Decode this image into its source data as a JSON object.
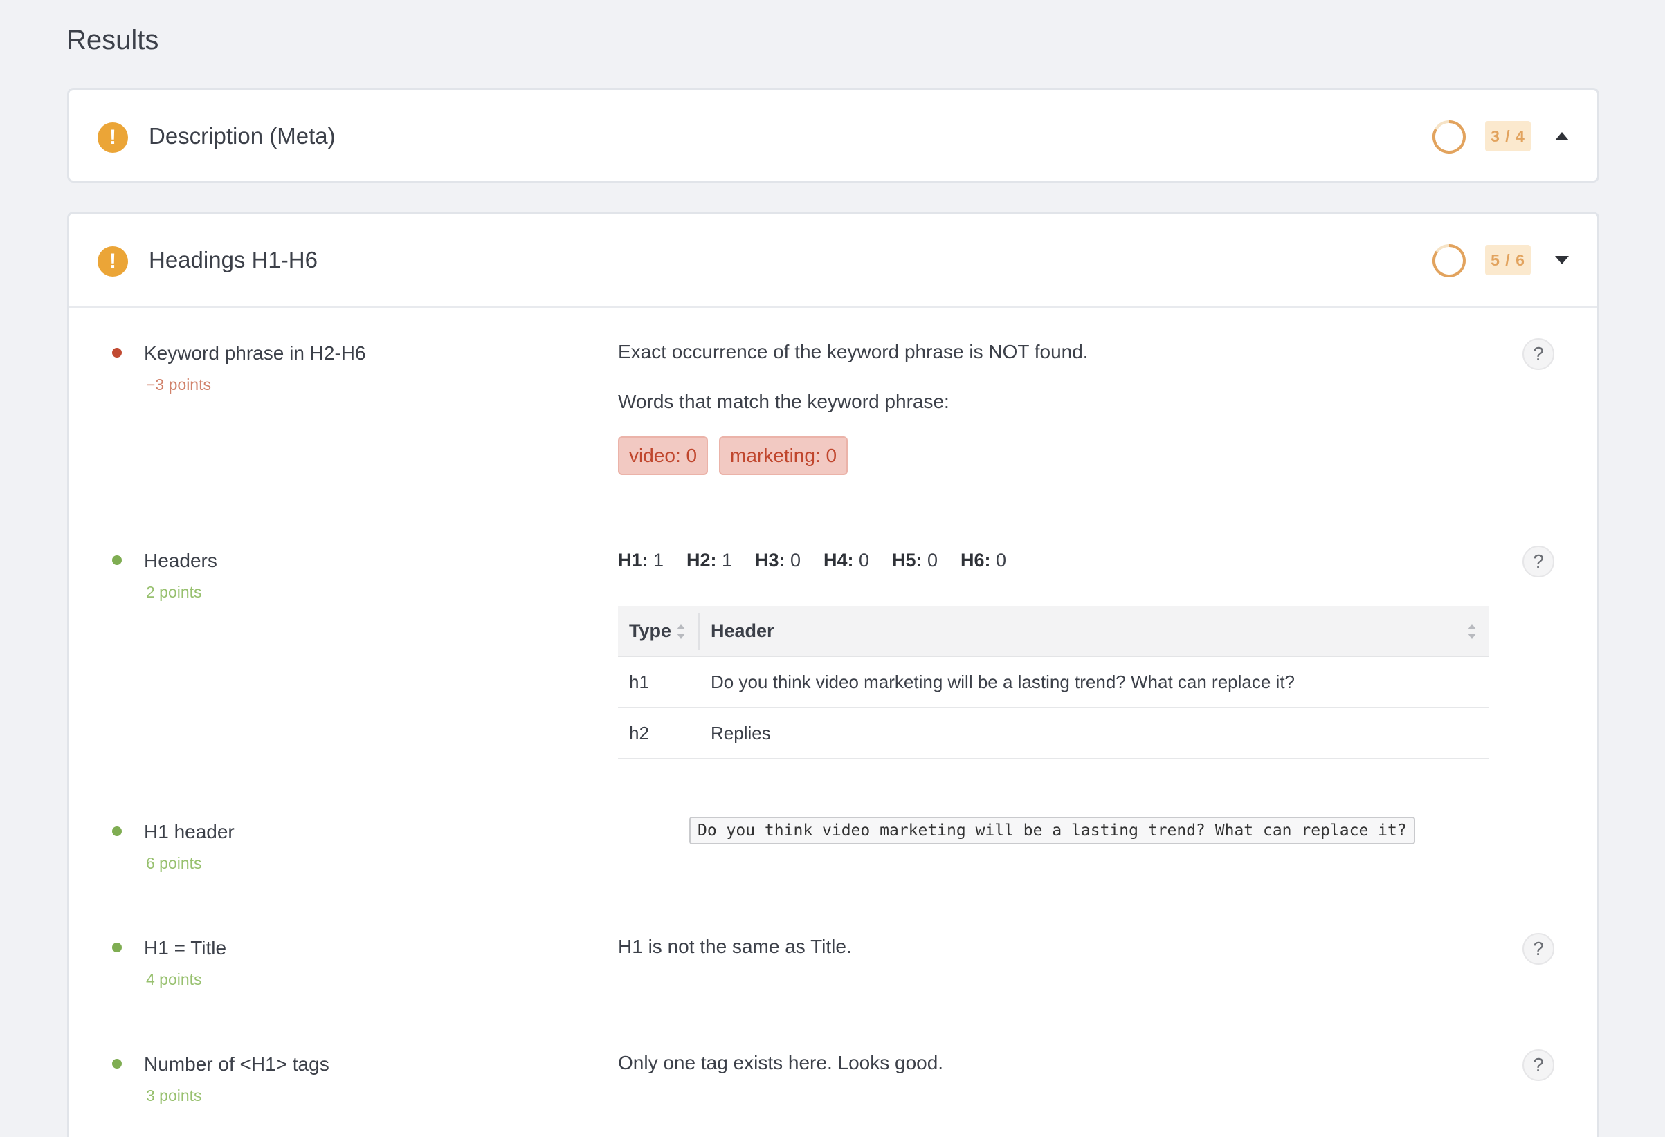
{
  "page": {
    "title": "Results"
  },
  "panels": {
    "meta": {
      "title": "Description (Meta)",
      "score": "3 / 4",
      "expanded": true
    },
    "headings": {
      "title": "Headings H1-H6",
      "score": "5 / 6",
      "expanded": false,
      "rows": [
        {
          "label": "Keyword phrase in H2-H6",
          "points": "−3 points",
          "status": "fail",
          "message": "Exact occurrence of the keyword phrase is NOT found.",
          "sub_message": "Words that match the keyword phrase:",
          "tags": [
            "video: 0",
            "marketing: 0"
          ]
        },
        {
          "label": "Headers",
          "points": "2 points",
          "status": "pass",
          "counts": [
            {
              "key": "H1:",
              "value": "1"
            },
            {
              "key": "H2:",
              "value": "1"
            },
            {
              "key": "H3:",
              "value": "0"
            },
            {
              "key": "H4:",
              "value": "0"
            },
            {
              "key": "H5:",
              "value": "0"
            },
            {
              "key": "H6:",
              "value": "0"
            }
          ],
          "table": {
            "columns": [
              "Type",
              "Header"
            ],
            "rows": [
              {
                "type": "h1",
                "header": "Do you think video marketing will be a lasting trend? What can replace it?"
              },
              {
                "type": "h2",
                "header": "Replies"
              }
            ]
          }
        },
        {
          "label": "H1 header",
          "points": "6 points",
          "status": "pass",
          "code": "Do you think video marketing will be a lasting trend? What can replace it?"
        },
        {
          "label": "H1 = Title",
          "points": "4 points",
          "status": "pass",
          "message": "H1 is not the same as Title."
        },
        {
          "label": "Number of <H1> tags",
          "points": "3 points",
          "status": "pass",
          "message": "Only one tag exists here. Looks good."
        }
      ]
    }
  },
  "help_label": "?",
  "icons": {
    "warning": "exclamation-circle-icon",
    "spinner": "progress-ring-icon",
    "caret_up": "caret-up-icon",
    "caret_down": "caret-down-icon",
    "sort": "sort-arrows-icon",
    "help": "question-circle-icon"
  },
  "colors": {
    "warning": "#eba537",
    "fail": "#c14a32",
    "pass": "#7fad52",
    "badge_bg": "#fbe9ce",
    "badge_text": "#e2a35e",
    "tag_bg": "#f2c9c2"
  }
}
